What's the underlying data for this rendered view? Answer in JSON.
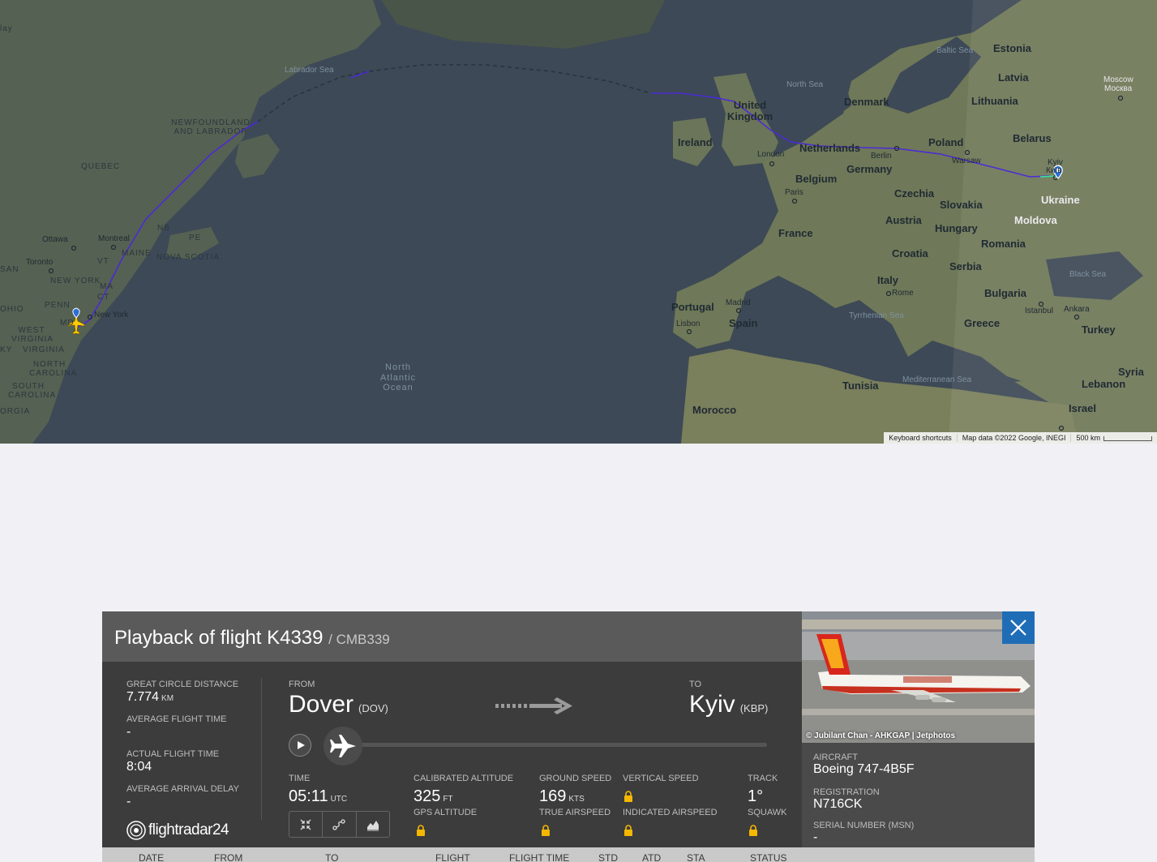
{
  "map": {
    "countries": [
      "Estonia",
      "Latvia",
      "Lithuania",
      "Denmark",
      "Belarus",
      "Poland",
      "United Kingdom",
      "Ireland",
      "Netherlands",
      "Germany",
      "Belgium",
      "Czechia",
      "Slovakia",
      "Ukraine",
      "Moldova",
      "Austria",
      "Hungary",
      "France",
      "Romania",
      "Croatia",
      "Serbia",
      "Italy",
      "Bulgaria",
      "Portugal",
      "Spain",
      "Greece",
      "Turkey",
      "Tunisia",
      "Morocco",
      "Syria",
      "Lebanon",
      "Israel"
    ],
    "cities": [
      "Moscow",
      "Москва",
      "Kyiv",
      "Київ",
      "Warsaw",
      "Berlin",
      "London",
      "Paris",
      "Madrid",
      "Lisbon",
      "Rome",
      "Istanbul",
      "Ankara",
      "Ottawa",
      "Montreal",
      "Toronto",
      "New York"
    ],
    "seas": [
      "Labrador Sea",
      "Baltic Sea",
      "North Sea",
      "Tyrrhenian Sea",
      "Mediterranean Sea",
      "Black Sea"
    ],
    "ocean": "North Atlantic Ocean",
    "regions": [
      "NEWFOUNDLAND AND LABRADOR",
      "QUEBEC",
      "NB",
      "PE",
      "NOVA SCOTIA",
      "MAINE",
      "VT",
      "NEW YORK",
      "MA",
      "CT",
      "PENN",
      "OHIO",
      "WEST VIRGINIA",
      "VIRGINIA",
      "NORTH CAROLINA",
      "SOUTH CAROLINA",
      "MD",
      "SAN",
      "ORGIA",
      "KY",
      "lay"
    ],
    "footer": {
      "shortcuts": "Keyboard shortcuts",
      "attribution": "Map data ©2022 Google, INEGI",
      "scale": "500 km"
    },
    "colors": {
      "track": "#4b2bd6",
      "track_dashed": "#2a3440",
      "marker": "#ffcc00"
    }
  },
  "panel": {
    "title": "Playback of flight K4339",
    "callsign": "/ CMB339",
    "stats": [
      {
        "key": "GREAT CIRCLE DISTANCE",
        "value": "7.774",
        "unit": "KM"
      },
      {
        "key": "AVERAGE FLIGHT TIME",
        "value": "-",
        "unit": ""
      },
      {
        "key": "ACTUAL FLIGHT TIME",
        "value": "8:04",
        "unit": ""
      },
      {
        "key": "AVERAGE ARRIVAL DELAY",
        "value": "-",
        "unit": ""
      }
    ],
    "from": {
      "label": "FROM",
      "city": "Dover",
      "code": "(DOV)"
    },
    "to": {
      "label": "TO",
      "city": "Kyiv",
      "code": "(KBP)"
    },
    "telemetry": {
      "time_label": "TIME",
      "time_value": "05:11",
      "time_unit": "UTC",
      "cal_alt_label": "CALIBRATED ALTITUDE",
      "cal_alt_value": "325",
      "cal_alt_unit": "FT",
      "gps_alt_label": "GPS ALTITUDE",
      "gs_label": "GROUND SPEED",
      "gs_value": "169",
      "gs_unit": "KTS",
      "tas_label": "TRUE AIRSPEED",
      "vs_label": "VERTICAL SPEED",
      "ias_label": "INDICATED AIRSPEED",
      "track_label": "TRACK",
      "track_value": "1°",
      "squawk_label": "SQUAWK"
    },
    "logo": "flightradar24",
    "photo_credit": "© Jubilant Chan - AHKGAP | Jetphotos",
    "aircraft": {
      "aircraft_label": "AIRCRAFT",
      "aircraft_value": "Boeing 747-4B5F",
      "reg_label": "REGISTRATION",
      "reg_value": "N716CK",
      "msn_label": "SERIAL NUMBER (MSN)",
      "msn_value": "-"
    },
    "table_headers": [
      "DATE",
      "FROM",
      "TO",
      "FLIGHT",
      "FLIGHT TIME",
      "STD",
      "ATD",
      "STA",
      "STATUS"
    ]
  }
}
